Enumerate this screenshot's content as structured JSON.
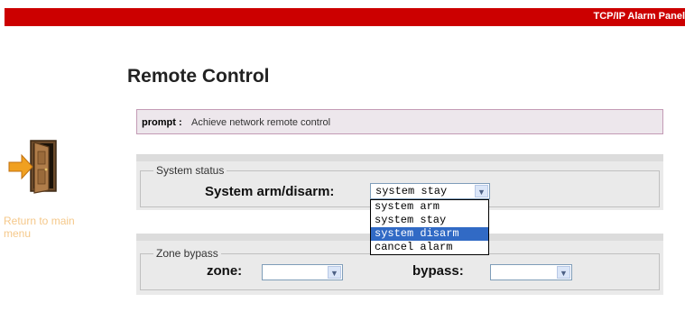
{
  "header": {
    "title": "TCP/IP Alarm Panel"
  },
  "page": {
    "title": "Remote Control"
  },
  "side": {
    "return_label": "Return to main menu",
    "icon": "door-exit-icon"
  },
  "prompt": {
    "label": "prompt :",
    "text": "Achieve network remote control"
  },
  "system_status": {
    "legend": "System status",
    "field_label": "System arm/disarm:",
    "selected": "system stay",
    "options": [
      "system arm",
      "system stay",
      "system disarm",
      "cancel alarm"
    ],
    "highlighted": "system disarm"
  },
  "zone_bypass": {
    "legend": "Zone bypass",
    "zone_label": "zone:",
    "zone_value": "",
    "bypass_label": "bypass:",
    "bypass_value": ""
  },
  "colors": {
    "brand": "#cc0000",
    "prompt_bg": "#ede7ec",
    "link": "#f5c88a",
    "highlight": "#316ac5"
  }
}
